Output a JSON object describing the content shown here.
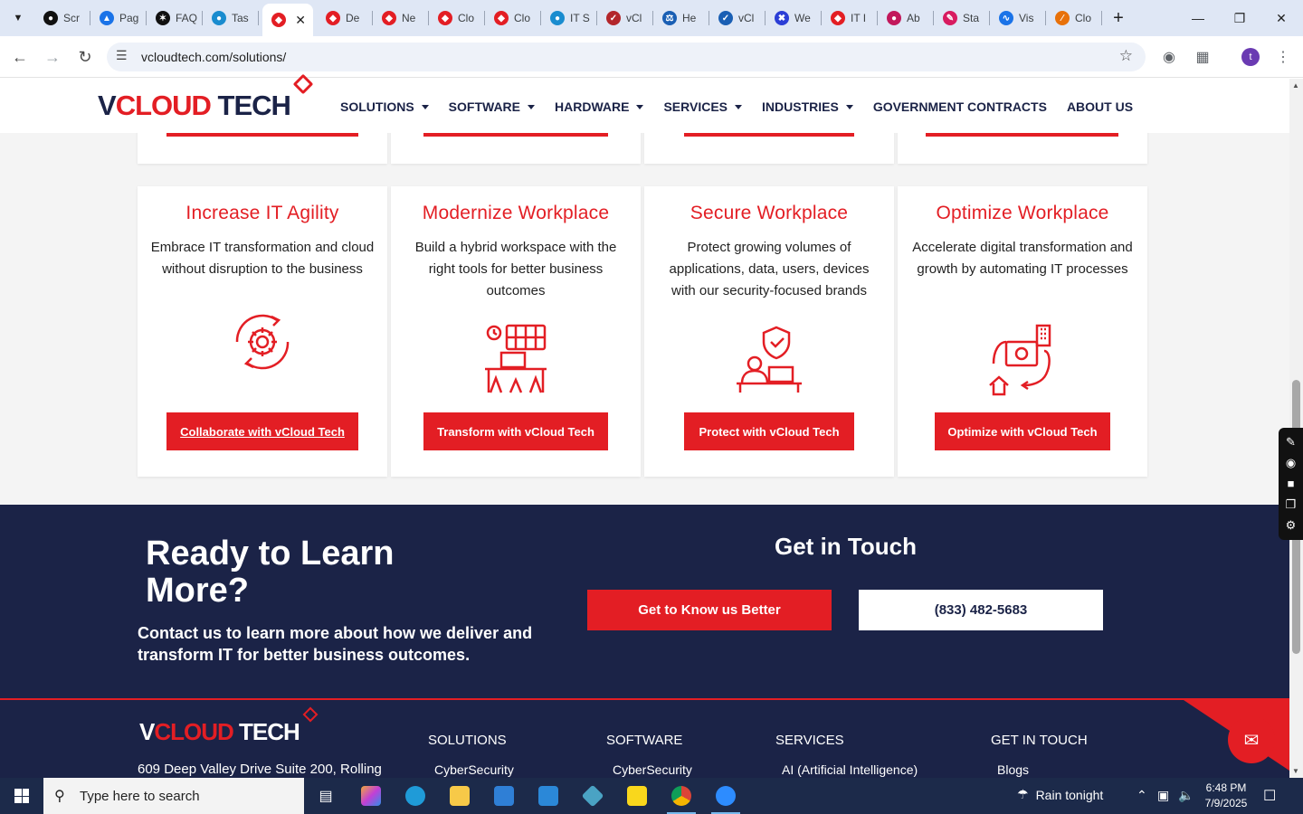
{
  "browser": {
    "tabs": [
      {
        "label": "Scr",
        "icon": "camera-icon",
        "color": "#111111"
      },
      {
        "label": "Pag",
        "icon": "pagespeed-icon",
        "color": "#1a73e8"
      },
      {
        "label": "FAQ",
        "icon": "openai-icon",
        "color": "#111111"
      },
      {
        "label": "Tas",
        "icon": "task-icon",
        "color": "#1a8ccf"
      },
      {
        "label": "",
        "icon": "vcloud-icon",
        "color": "#e31e24",
        "active": true
      },
      {
        "label": "De",
        "icon": "vcloud-icon",
        "color": "#e31e24"
      },
      {
        "label": "Ne",
        "icon": "vcloud-icon",
        "color": "#e31e24"
      },
      {
        "label": "Clo",
        "icon": "vcloud-icon",
        "color": "#e31e24"
      },
      {
        "label": "Clo",
        "icon": "vcloud-icon",
        "color": "#e31e24"
      },
      {
        "label": "IT S",
        "icon": "task-icon",
        "color": "#1a8ccf"
      },
      {
        "label": "vCl",
        "icon": "check-v-icon",
        "color": "#b3262b"
      },
      {
        "label": "He",
        "icon": "scale-icon",
        "color": "#1a5fb4"
      },
      {
        "label": "vCl",
        "icon": "check-icon",
        "color": "#1a5fb4"
      },
      {
        "label": "We",
        "icon": "x-cross-icon",
        "color": "#2b3ed6"
      },
      {
        "label": "IT I",
        "icon": "vcloud-icon",
        "color": "#e31e24"
      },
      {
        "label": "Ab",
        "icon": "ab-icon",
        "color": "#c2185b"
      },
      {
        "label": "Sta",
        "icon": "pen-icon",
        "color": "#d81b60"
      },
      {
        "label": "Vis",
        "icon": "pulse-icon",
        "color": "#1a73e8"
      },
      {
        "label": "Clo",
        "icon": "slash-icon",
        "color": "#e8710a"
      }
    ],
    "url": "vcloudtech.com/solutions/",
    "avatar_initial": "t"
  },
  "site": {
    "logo": {
      "v": "V",
      "cloud": "CLOUD",
      "tech": "TECH"
    },
    "nav": [
      {
        "label": "SOLUTIONS",
        "dropdown": true
      },
      {
        "label": "SOFTWARE",
        "dropdown": true
      },
      {
        "label": "HARDWARE",
        "dropdown": true
      },
      {
        "label": "SERVICES",
        "dropdown": true
      },
      {
        "label": "INDUSTRIES",
        "dropdown": true
      },
      {
        "label": "GOVERNMENT CONTRACTS",
        "dropdown": false
      },
      {
        "label": "ABOUT US",
        "dropdown": false
      }
    ]
  },
  "cards": [
    {
      "title": "Increase IT Agility",
      "text": "Embrace IT transformation and cloud without disruption to the business",
      "icon": "gear-cycle-icon",
      "cta": "Collaborate with vCloud Tech"
    },
    {
      "title": "Modernize Workplace",
      "text": "Build a hybrid workspace with the right tools for better business outcomes",
      "icon": "office-desk-icon",
      "cta": "Transform with vCloud Tech"
    },
    {
      "title": "Secure Workplace",
      "text": "Protect growing volumes of applications, data, users, devices with our security-focused brands",
      "icon": "shield-worker-icon",
      "cta": "Protect with vCloud Tech"
    },
    {
      "title": "Optimize Workplace",
      "text": "Accelerate digital transformation and growth by automating IT processes",
      "icon": "automation-icon",
      "cta": "Optimize with vCloud Tech"
    }
  ],
  "cta_band": {
    "heading": "Ready to Learn More?",
    "subtext": "Contact us to learn more about how we deliver and transform IT for better business outcomes.",
    "get_in_touch": "Get in Touch",
    "primary_button": "Get to Know us Better",
    "phone_button": "(833) 482-5683"
  },
  "footer": {
    "address": "609 Deep Valley Drive Suite 200, Rolling",
    "columns": [
      {
        "heading": "SOLUTIONS",
        "first_link": "CyberSecurity"
      },
      {
        "heading": "SOFTWARE",
        "first_link": "CyberSecurity"
      },
      {
        "heading": "SERVICES",
        "first_link": "AI (Artificial Intelligence)"
      },
      {
        "heading": "GET IN TOUCH",
        "first_link": "Blogs"
      }
    ]
  },
  "taskbar": {
    "search_placeholder": "Type here to search",
    "weather": "Rain tonight",
    "time": "6:48 PM",
    "date": "7/9/2025"
  },
  "colors": {
    "brand_red": "#e31e24",
    "navy": "#1b2347"
  }
}
